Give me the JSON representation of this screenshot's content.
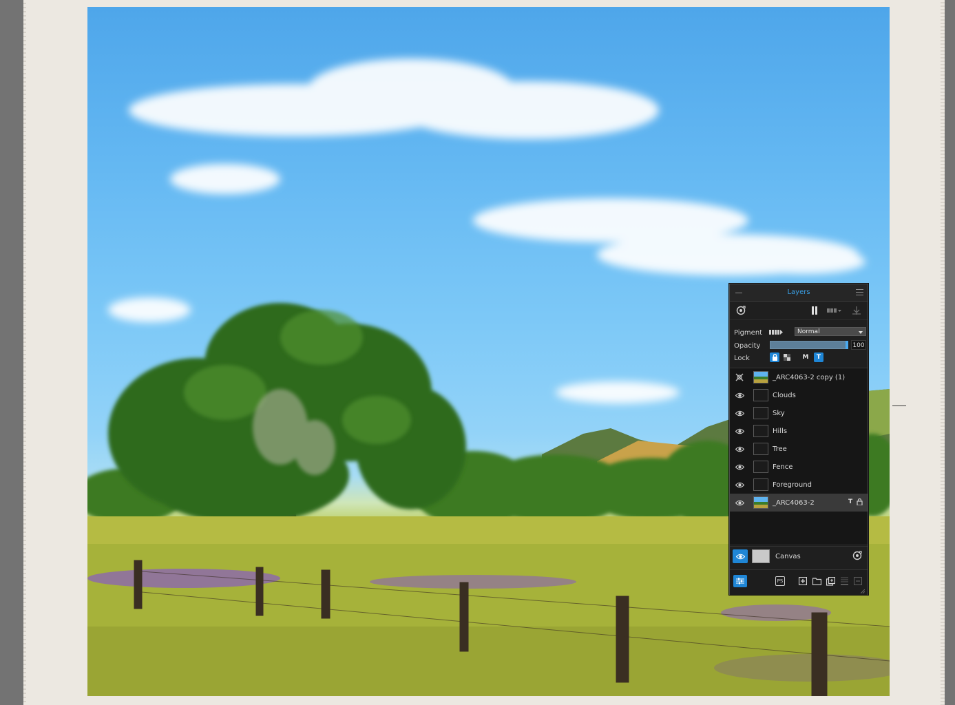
{
  "panel": {
    "title": "Layers",
    "pigment_label": "Pigment",
    "blend_mode": "Normal",
    "opacity_label": "Opacity",
    "opacity_value": "100",
    "opacity_fraction": 1.0,
    "lock_label": "Lock",
    "lock_m": "M",
    "lock_t": "T",
    "accent_color": "#1f86d6",
    "title_color": "#3aa0e6"
  },
  "layers": [
    {
      "name": "_ARC4063-2 copy (1)",
      "visible": false,
      "thumb": "image",
      "selected": false
    },
    {
      "name": "Clouds",
      "visible": true,
      "thumb": "empty",
      "selected": false
    },
    {
      "name": "Sky",
      "visible": true,
      "thumb": "empty",
      "selected": false
    },
    {
      "name": "Hills",
      "visible": true,
      "thumb": "empty",
      "selected": false
    },
    {
      "name": "Tree",
      "visible": true,
      "thumb": "empty",
      "selected": false
    },
    {
      "name": "Fence",
      "visible": true,
      "thumb": "empty",
      "selected": false
    },
    {
      "name": "Foreground",
      "visible": true,
      "thumb": "empty",
      "selected": false
    },
    {
      "name": "_ARC4063-2",
      "visible": true,
      "thumb": "image",
      "selected": true,
      "badge_t": "T"
    }
  ],
  "canvas": {
    "label": "Canvas"
  },
  "bottom": {
    "ps_label": "PS"
  },
  "icons": [
    "minimize-icon",
    "panel-menu-icon",
    "reset-eye-icon",
    "pause-icon",
    "pigment-dropdown-icon",
    "water-icon",
    "pigment-icon",
    "lock-icon",
    "transparency-lock-icon",
    "eye-icon",
    "hidden-eye-icon",
    "text-layer-icon",
    "layer-lock-icon",
    "canvas-eye-icon",
    "canvas-visibility-icon",
    "layer-settings-icon",
    "photoshop-icon",
    "add-layer-icon",
    "add-folder-icon",
    "duplicate-layer-icon",
    "merge-layer-icon",
    "delete-layer-icon",
    "resize-grip-icon"
  ]
}
